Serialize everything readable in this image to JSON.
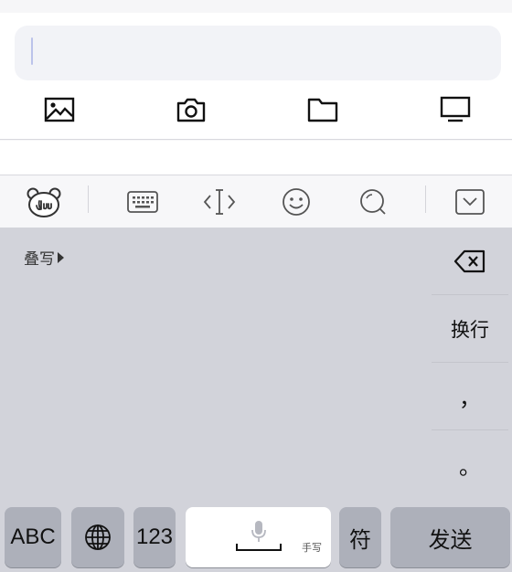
{
  "composer": {
    "input_value": "",
    "attachments": [
      {
        "id": "photo",
        "icon": "image-icon"
      },
      {
        "id": "camera",
        "icon": "camera-icon"
      },
      {
        "id": "file",
        "icon": "folder-icon"
      },
      {
        "id": "screen",
        "icon": "monitor-icon"
      }
    ]
  },
  "toolbar": {
    "items": [
      {
        "id": "logo",
        "icon": "du-bear-logo-icon"
      },
      {
        "id": "keyboard",
        "icon": "keyboard-icon"
      },
      {
        "id": "cursor",
        "icon": "cursor-move-icon"
      },
      {
        "id": "emoji",
        "icon": "smiley-icon"
      },
      {
        "id": "search",
        "icon": "search-icon"
      },
      {
        "id": "collapse",
        "icon": "chevron-down-box-icon"
      }
    ]
  },
  "keyboard": {
    "mode_label": "叠写",
    "side_keys": {
      "newline": "换行",
      "comma": "，",
      "period": "。"
    },
    "bottom_keys": {
      "abc": "ABC",
      "numbers": "123",
      "space_sub": "手写",
      "symbols": "符",
      "send": "发送"
    }
  },
  "colors": {
    "keyboard_bg": "#d2d3da",
    "function_key": "#adb0ba",
    "caret": "#bcc3ea"
  }
}
